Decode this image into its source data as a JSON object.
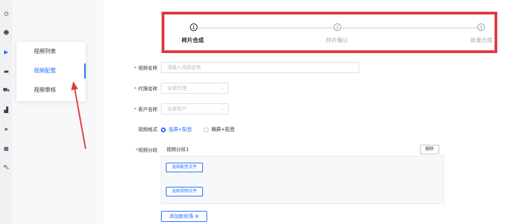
{
  "sidebar": {
    "icons": [
      "clock-icon",
      "user-icon",
      "video-icon",
      "briefcase-icon",
      "cart-icon",
      "factory-icon",
      "send-icon",
      "calendar-icon",
      "bus-icon"
    ],
    "active_index": 2
  },
  "submenu": {
    "items": [
      {
        "label": "视频列表"
      },
      {
        "label": "视频配置"
      },
      {
        "label": "视频审核"
      }
    ],
    "active_index": 1
  },
  "steps": [
    {
      "num": "1",
      "label": "样片合成"
    },
    {
      "num": "2",
      "label": "样片确认"
    },
    {
      "num": "3",
      "label": "批量合成"
    }
  ],
  "form": {
    "video_name": {
      "label": "视频名称",
      "placeholder": "请输入视频名称"
    },
    "agent_name": {
      "label": "代理名称",
      "placeholder": "全部代理"
    },
    "customer_name": {
      "label": "客户名称",
      "placeholder": "全部客户"
    },
    "video_format": {
      "label": "视频格式",
      "options": [
        "竖屏+配音",
        "横屏+配音"
      ],
      "selected": 0
    },
    "video_segment": {
      "label": "视频分段",
      "segment_title": "视频分段1",
      "delete_label": "删除",
      "select_audio": "选取配音文件",
      "select_video": "选取视频文件"
    },
    "add_paragraph": "添加新段落 ⊕"
  },
  "colors": {
    "accent": "#1f6fff",
    "highlight_border": "#e03a3a"
  }
}
